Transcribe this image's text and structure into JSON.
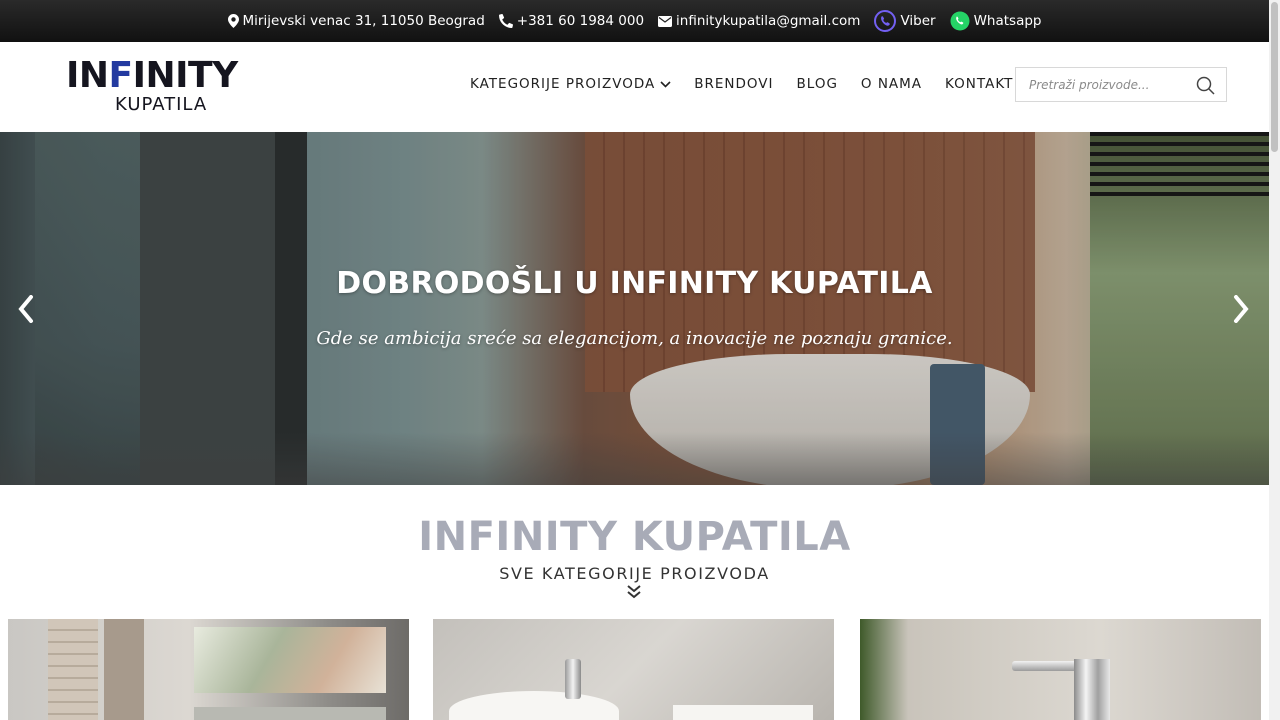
{
  "topbar": {
    "address": "Mirijevski venac 31, 11050 Beograd",
    "phone": "+381 60 1984 000",
    "email": "infinitykupatila@gmail.com",
    "viber": "Viber",
    "whatsapp": "Whatsapp",
    "colors": {
      "viber": "#7360f2",
      "whatsapp": "#25d366"
    }
  },
  "logo": {
    "main_a": "IN",
    "main_accent": "F",
    "main_b": "INITY",
    "sub": "KUPATILA"
  },
  "nav": {
    "items": [
      {
        "label": "KATEGORIJE PROIZVODA",
        "has_dropdown": true
      },
      {
        "label": "BRENDOVI"
      },
      {
        "label": "BLOG"
      },
      {
        "label": "O NAMA"
      },
      {
        "label": "KONTAKT"
      }
    ]
  },
  "search": {
    "placeholder": "Pretraži proizvode..."
  },
  "hero": {
    "title": "DOBRODOŠLI U INFINITY KUPATILA",
    "subtitle": "Gde se ambicija sreće sa elegancijom, a inovacije ne poznaju granice."
  },
  "section": {
    "title": "INFINITY KUPATILA",
    "subtitle": "SVE KATEGORIJE PROIZVODA"
  },
  "colors": {
    "accent_logo": "#233aa0",
    "section_title": "#a8abb7"
  }
}
